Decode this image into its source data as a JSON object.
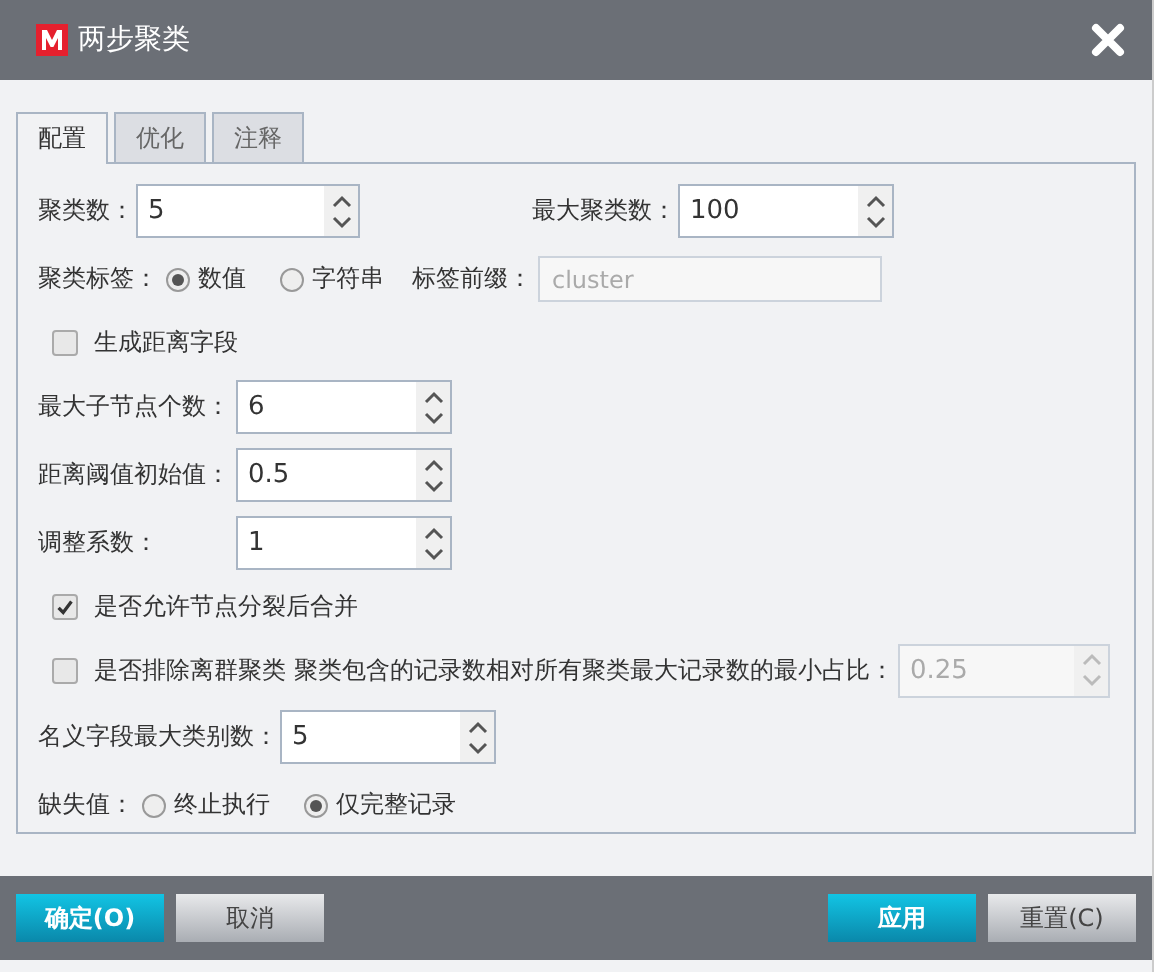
{
  "window": {
    "title": "两步聚类"
  },
  "tabs": [
    {
      "label": "配置",
      "selected": true
    },
    {
      "label": "优化",
      "selected": false
    },
    {
      "label": "注释",
      "selected": false
    }
  ],
  "rows": [
    {
      "kind": "spin_pair",
      "fields": [
        {
          "label": "聚类数：",
          "value": "5"
        },
        {
          "label": "最大聚类数：",
          "value": "100"
        }
      ]
    },
    {
      "kind": "radio",
      "label": "聚类标签：",
      "options": [
        {
          "label": "数值",
          "selected": true
        },
        {
          "label": "字符串",
          "selected": false
        }
      ],
      "field": {
        "label": "标签前缀：",
        "value": "cluster",
        "disabled": true
      }
    },
    {
      "kind": "checkbox",
      "label": "生成距离字段",
      "checked": false
    },
    {
      "kind": "spin",
      "label": "最大子节点个数：",
      "value": "6"
    },
    {
      "kind": "spin",
      "label": "距离阈值初始值：",
      "value": "0.5"
    },
    {
      "kind": "spin",
      "label": "调整系数：",
      "value": "1"
    },
    {
      "kind": "checkbox",
      "label": "是否允许节点分裂后合并",
      "checked": true
    },
    {
      "kind": "checkbox_spin",
      "label": "是否排除离群聚类",
      "sublabel": "聚类包含的记录数相对所有聚类最大记录数的最小占比：",
      "value": "0.25",
      "checked": false,
      "disabled": true
    },
    {
      "kind": "spin",
      "label": "名义字段最大类别数：",
      "value": "5"
    },
    {
      "kind": "radio",
      "label": "缺失值：",
      "options": [
        {
          "label": "终止执行",
          "selected": false
        },
        {
          "label": "仅完整记录",
          "selected": true
        }
      ]
    }
  ],
  "buttons_left": [
    {
      "label": "确定(O)",
      "primary": true
    },
    {
      "label": "取消",
      "primary": false
    }
  ],
  "buttons_right": [
    {
      "label": "应用",
      "primary": true
    },
    {
      "label": "重置(C)",
      "primary": false
    }
  ]
}
